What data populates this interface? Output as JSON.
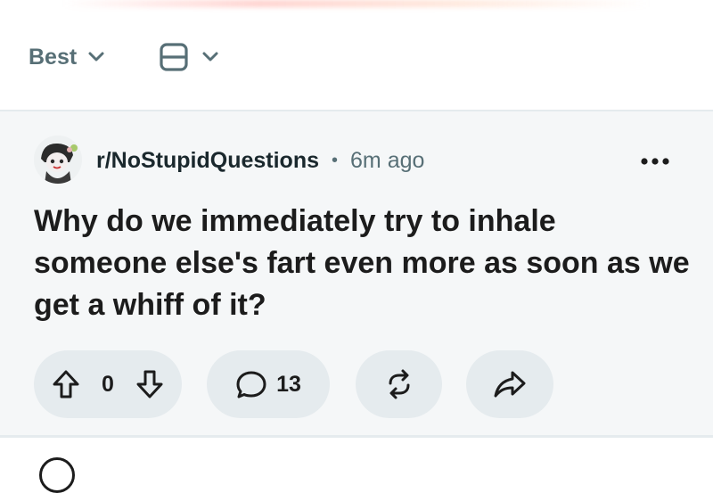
{
  "toolbar": {
    "sort_label": "Best",
    "sort_chevron_icon": "chevron-down-icon",
    "view_icon": "card-view-icon",
    "view_chevron_icon": "chevron-down-icon"
  },
  "post": {
    "subreddit": "r/NoStupidQuestions",
    "separator": "•",
    "time_ago": "6m ago",
    "more_icon": "more-horizontal-icon",
    "title": "Why do we immediately try to inhale someone else's fart even more as soon as we get a whiff of it?",
    "vote_count": "0",
    "comment_count": "13",
    "icons": {
      "upvote": "upvote-arrow-icon",
      "downvote": "downvote-arrow-icon",
      "comment": "comment-bubble-icon",
      "repost": "repost-icon",
      "share": "share-arrow-icon"
    }
  },
  "colors": {
    "background": "#ffffff",
    "post_background": "#f5f7f8",
    "pill_background": "#e5ebee",
    "muted_text": "#576f76",
    "text": "#1c1c1c"
  }
}
